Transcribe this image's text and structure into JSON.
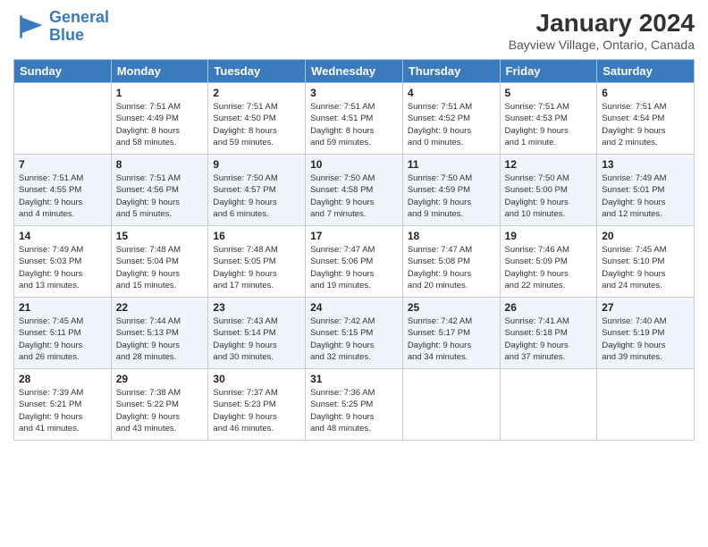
{
  "header": {
    "logo_line1": "General",
    "logo_line2": "Blue",
    "title": "January 2024",
    "subtitle": "Bayview Village, Ontario, Canada"
  },
  "days_of_week": [
    "Sunday",
    "Monday",
    "Tuesday",
    "Wednesday",
    "Thursday",
    "Friday",
    "Saturday"
  ],
  "weeks": [
    [
      {
        "day": "",
        "info": ""
      },
      {
        "day": "1",
        "info": "Sunrise: 7:51 AM\nSunset: 4:49 PM\nDaylight: 8 hours\nand 58 minutes."
      },
      {
        "day": "2",
        "info": "Sunrise: 7:51 AM\nSunset: 4:50 PM\nDaylight: 8 hours\nand 59 minutes."
      },
      {
        "day": "3",
        "info": "Sunrise: 7:51 AM\nSunset: 4:51 PM\nDaylight: 8 hours\nand 59 minutes."
      },
      {
        "day": "4",
        "info": "Sunrise: 7:51 AM\nSunset: 4:52 PM\nDaylight: 9 hours\nand 0 minutes."
      },
      {
        "day": "5",
        "info": "Sunrise: 7:51 AM\nSunset: 4:53 PM\nDaylight: 9 hours\nand 1 minute."
      },
      {
        "day": "6",
        "info": "Sunrise: 7:51 AM\nSunset: 4:54 PM\nDaylight: 9 hours\nand 2 minutes."
      }
    ],
    [
      {
        "day": "7",
        "info": "Sunrise: 7:51 AM\nSunset: 4:55 PM\nDaylight: 9 hours\nand 4 minutes."
      },
      {
        "day": "8",
        "info": "Sunrise: 7:51 AM\nSunset: 4:56 PM\nDaylight: 9 hours\nand 5 minutes."
      },
      {
        "day": "9",
        "info": "Sunrise: 7:50 AM\nSunset: 4:57 PM\nDaylight: 9 hours\nand 6 minutes."
      },
      {
        "day": "10",
        "info": "Sunrise: 7:50 AM\nSunset: 4:58 PM\nDaylight: 9 hours\nand 7 minutes."
      },
      {
        "day": "11",
        "info": "Sunrise: 7:50 AM\nSunset: 4:59 PM\nDaylight: 9 hours\nand 9 minutes."
      },
      {
        "day": "12",
        "info": "Sunrise: 7:50 AM\nSunset: 5:00 PM\nDaylight: 9 hours\nand 10 minutes."
      },
      {
        "day": "13",
        "info": "Sunrise: 7:49 AM\nSunset: 5:01 PM\nDaylight: 9 hours\nand 12 minutes."
      }
    ],
    [
      {
        "day": "14",
        "info": "Sunrise: 7:49 AM\nSunset: 5:03 PM\nDaylight: 9 hours\nand 13 minutes."
      },
      {
        "day": "15",
        "info": "Sunrise: 7:48 AM\nSunset: 5:04 PM\nDaylight: 9 hours\nand 15 minutes."
      },
      {
        "day": "16",
        "info": "Sunrise: 7:48 AM\nSunset: 5:05 PM\nDaylight: 9 hours\nand 17 minutes."
      },
      {
        "day": "17",
        "info": "Sunrise: 7:47 AM\nSunset: 5:06 PM\nDaylight: 9 hours\nand 19 minutes."
      },
      {
        "day": "18",
        "info": "Sunrise: 7:47 AM\nSunset: 5:08 PM\nDaylight: 9 hours\nand 20 minutes."
      },
      {
        "day": "19",
        "info": "Sunrise: 7:46 AM\nSunset: 5:09 PM\nDaylight: 9 hours\nand 22 minutes."
      },
      {
        "day": "20",
        "info": "Sunrise: 7:45 AM\nSunset: 5:10 PM\nDaylight: 9 hours\nand 24 minutes."
      }
    ],
    [
      {
        "day": "21",
        "info": "Sunrise: 7:45 AM\nSunset: 5:11 PM\nDaylight: 9 hours\nand 26 minutes."
      },
      {
        "day": "22",
        "info": "Sunrise: 7:44 AM\nSunset: 5:13 PM\nDaylight: 9 hours\nand 28 minutes."
      },
      {
        "day": "23",
        "info": "Sunrise: 7:43 AM\nSunset: 5:14 PM\nDaylight: 9 hours\nand 30 minutes."
      },
      {
        "day": "24",
        "info": "Sunrise: 7:42 AM\nSunset: 5:15 PM\nDaylight: 9 hours\nand 32 minutes."
      },
      {
        "day": "25",
        "info": "Sunrise: 7:42 AM\nSunset: 5:17 PM\nDaylight: 9 hours\nand 34 minutes."
      },
      {
        "day": "26",
        "info": "Sunrise: 7:41 AM\nSunset: 5:18 PM\nDaylight: 9 hours\nand 37 minutes."
      },
      {
        "day": "27",
        "info": "Sunrise: 7:40 AM\nSunset: 5:19 PM\nDaylight: 9 hours\nand 39 minutes."
      }
    ],
    [
      {
        "day": "28",
        "info": "Sunrise: 7:39 AM\nSunset: 5:21 PM\nDaylight: 9 hours\nand 41 minutes."
      },
      {
        "day": "29",
        "info": "Sunrise: 7:38 AM\nSunset: 5:22 PM\nDaylight: 9 hours\nand 43 minutes."
      },
      {
        "day": "30",
        "info": "Sunrise: 7:37 AM\nSunset: 5:23 PM\nDaylight: 9 hours\nand 46 minutes."
      },
      {
        "day": "31",
        "info": "Sunrise: 7:36 AM\nSunset: 5:25 PM\nDaylight: 9 hours\nand 48 minutes."
      },
      {
        "day": "",
        "info": ""
      },
      {
        "day": "",
        "info": ""
      },
      {
        "day": "",
        "info": ""
      }
    ]
  ]
}
